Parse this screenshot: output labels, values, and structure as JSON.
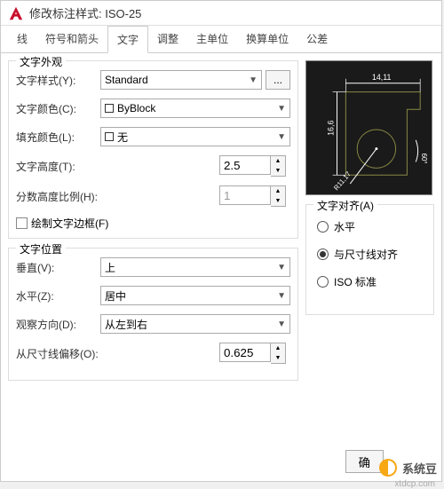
{
  "window": {
    "title": "修改标注样式: ISO-25"
  },
  "tabs": [
    "线",
    "符号和箭头",
    "文字",
    "调整",
    "主单位",
    "换算单位",
    "公差"
  ],
  "active_tab_index": 2,
  "appearance": {
    "title": "文字外观",
    "style_label": "文字样式(Y):",
    "style_value": "Standard",
    "color_label": "文字颜色(C):",
    "color_value": "ByBlock",
    "fill_label": "填充颜色(L):",
    "fill_value": "无",
    "height_label": "文字高度(T):",
    "height_value": "2.5",
    "fraction_label": "分数高度比例(H):",
    "fraction_value": "1",
    "frame_label": "绘制文字边框(F)"
  },
  "position": {
    "title": "文字位置",
    "vertical_label": "垂直(V):",
    "vertical_value": "上",
    "horizontal_label": "水平(Z):",
    "horizontal_value": "居中",
    "view_label": "观察方向(D):",
    "view_value": "从左到右",
    "offset_label": "从尺寸线偏移(O):",
    "offset_value": "0.625"
  },
  "alignment": {
    "title": "文字对齐(A)",
    "options": [
      "水平",
      "与尺寸线对齐",
      "ISO 标准"
    ],
    "selected_index": 1
  },
  "preview": {
    "dim1": "14,11",
    "dim2": "16,6",
    "dim3": "R11,17",
    "dim4": "60°"
  },
  "watermark": {
    "text": "系统豆",
    "url": "xtdcp.com"
  }
}
